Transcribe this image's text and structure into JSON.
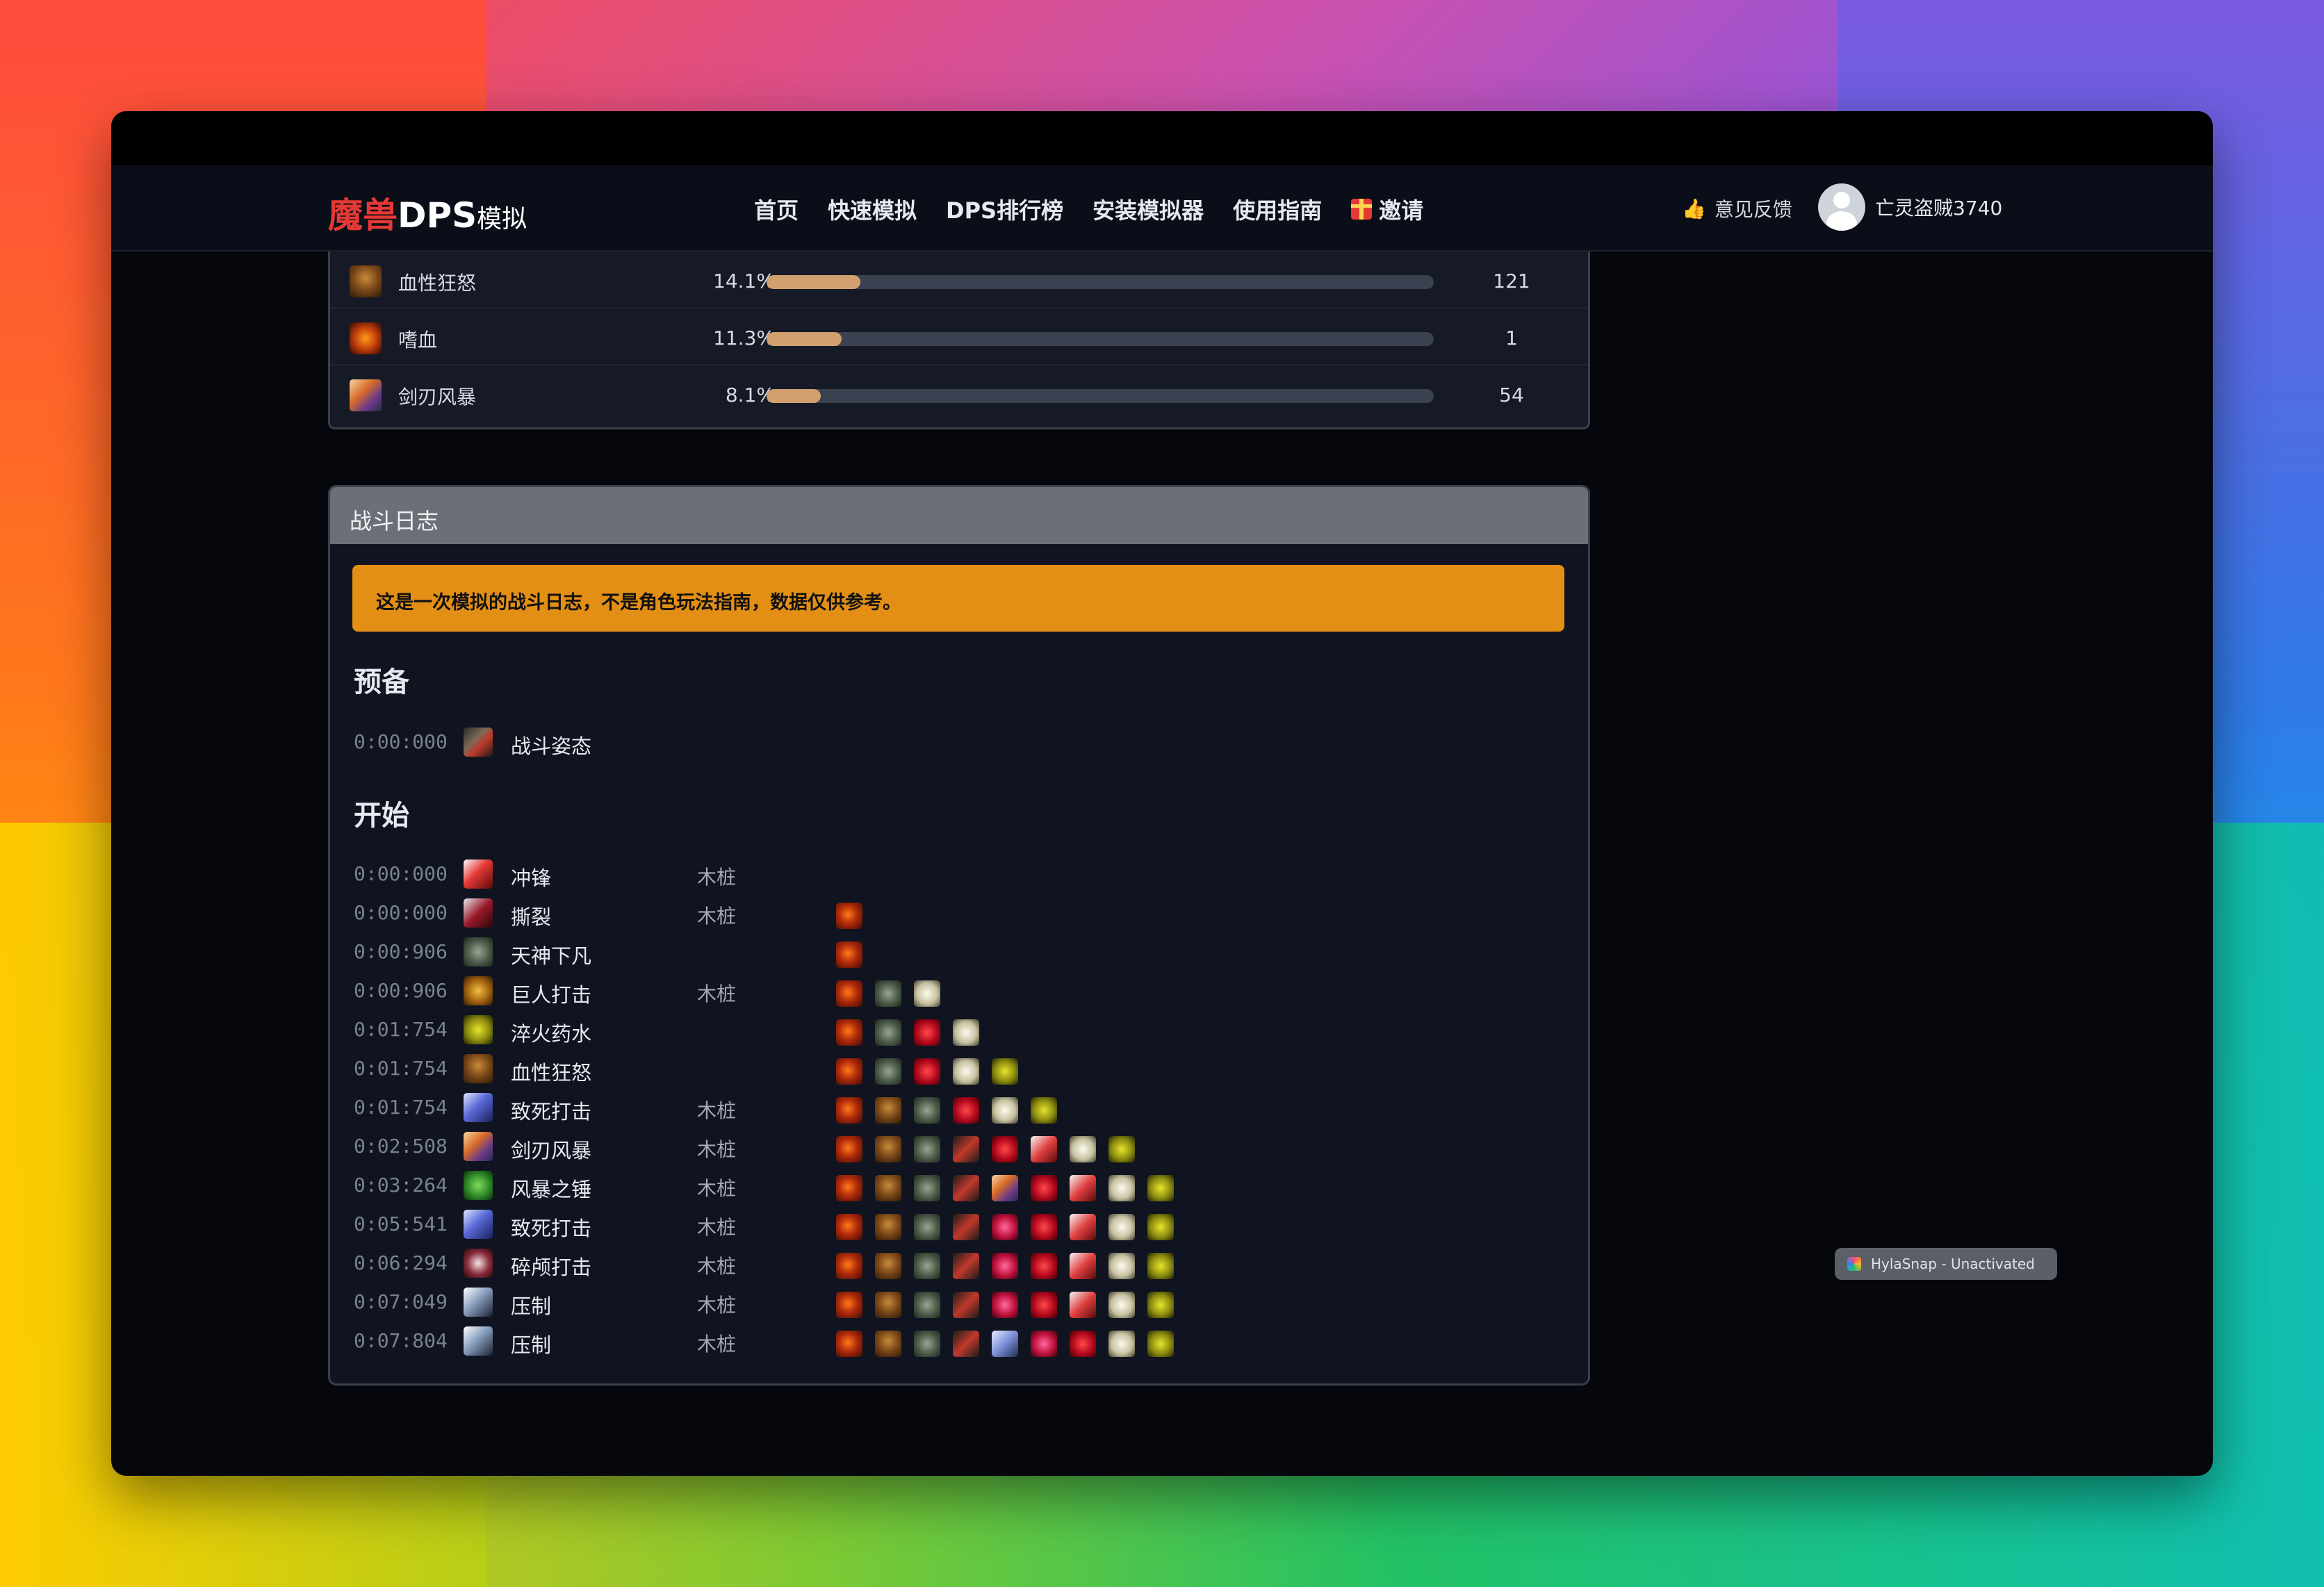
{
  "nav": {
    "logo_red": "魔兽",
    "logo_main": "DPS",
    "logo_small": "模拟",
    "menu": [
      "首页",
      "快速模拟",
      "DPS排行榜",
      "安装模拟器",
      "使用指南",
      "邀请"
    ],
    "feedback": "意见反馈",
    "username": "亡灵盗贼3740"
  },
  "buffs": [
    {
      "name": "血性狂怒",
      "pct": "14.1%",
      "fill": 0.141,
      "count": "121",
      "icon": "frenzy-icon"
    },
    {
      "name": "嗜血",
      "pct": "11.3%",
      "fill": 0.113,
      "count": "1",
      "icon": "bloodlust-icon"
    },
    {
      "name": "剑刃风暴",
      "pct": "8.1%",
      "fill": 0.081,
      "count": "54",
      "icon": "bladestorm-icon"
    }
  ],
  "log": {
    "title": "战斗日志",
    "notice": "这是一次模拟的战斗日志，不是角色玩法指南，数据仅供参考。",
    "sections": [
      {
        "title": "预备",
        "events": [
          {
            "time": "0:00:000",
            "icon": "stance",
            "name": "战斗姿态",
            "target": "",
            "buffs": []
          }
        ]
      },
      {
        "title": "开始",
        "events": [
          {
            "time": "0:00:000",
            "icon": "charge",
            "name": "冲锋",
            "target": "木桩",
            "buffs": []
          },
          {
            "time": "0:00:000",
            "icon": "rend",
            "name": "撕裂",
            "target": "木桩",
            "buffs": [
              "rage"
            ]
          },
          {
            "time": "0:00:906",
            "icon": "avatar",
            "name": "天神下凡",
            "target": "",
            "buffs": [
              "rage"
            ]
          },
          {
            "time": "0:00:906",
            "icon": "colossus",
            "name": "巨人打击",
            "target": "木桩",
            "buffs": [
              "rage",
              "avatar",
              "white"
            ]
          },
          {
            "time": "0:01:754",
            "icon": "potion",
            "name": "淬火药水",
            "target": "",
            "buffs": [
              "rage",
              "avatar",
              "red",
              "white"
            ]
          },
          {
            "time": "0:01:754",
            "icon": "frenzy",
            "name": "血性狂怒",
            "target": "",
            "buffs": [
              "rage",
              "avatar",
              "red",
              "white",
              "potion"
            ]
          },
          {
            "time": "0:01:754",
            "icon": "mortal",
            "name": "致死打击",
            "target": "木桩",
            "buffs": [
              "rage",
              "frenzy",
              "avatar",
              "red",
              "white",
              "potion"
            ]
          },
          {
            "time": "0:02:508",
            "icon": "blade",
            "name": "剑刃风暴",
            "target": "木桩",
            "buffs": [
              "rage",
              "frenzy",
              "avatar",
              "claw",
              "red",
              "slice",
              "white",
              "potion"
            ]
          },
          {
            "time": "0:03:264",
            "icon": "storm",
            "name": "风暴之锤",
            "target": "木桩",
            "buffs": [
              "rage",
              "frenzy",
              "avatar",
              "claw",
              "blade",
              "red",
              "slice",
              "white",
              "potion"
            ]
          },
          {
            "time": "0:05:541",
            "icon": "mortal",
            "name": "致死打击",
            "target": "木桩",
            "buffs": [
              "rage",
              "frenzy",
              "avatar",
              "claw",
              "swirl",
              "red",
              "slice",
              "white",
              "potion"
            ]
          },
          {
            "time": "0:06:294",
            "icon": "skull",
            "name": "碎颅打击",
            "target": "木桩",
            "buffs": [
              "rage",
              "frenzy",
              "avatar",
              "claw",
              "swirl",
              "red",
              "slice",
              "white",
              "potion"
            ]
          },
          {
            "time": "0:07:049",
            "icon": "suppress",
            "name": "压制",
            "target": "木桩",
            "buffs": [
              "rage",
              "frenzy",
              "avatar",
              "claw",
              "swirl",
              "red",
              "slice",
              "white",
              "potion"
            ]
          },
          {
            "time": "0:07:804",
            "icon": "suppress",
            "name": "压制",
            "target": "木桩",
            "buffs": [
              "rage",
              "frenzy",
              "avatar",
              "claw",
              "blue",
              "swirl",
              "red",
              "white",
              "potion"
            ]
          }
        ]
      }
    ]
  },
  "badge": "HylaSnap - Unactivated"
}
